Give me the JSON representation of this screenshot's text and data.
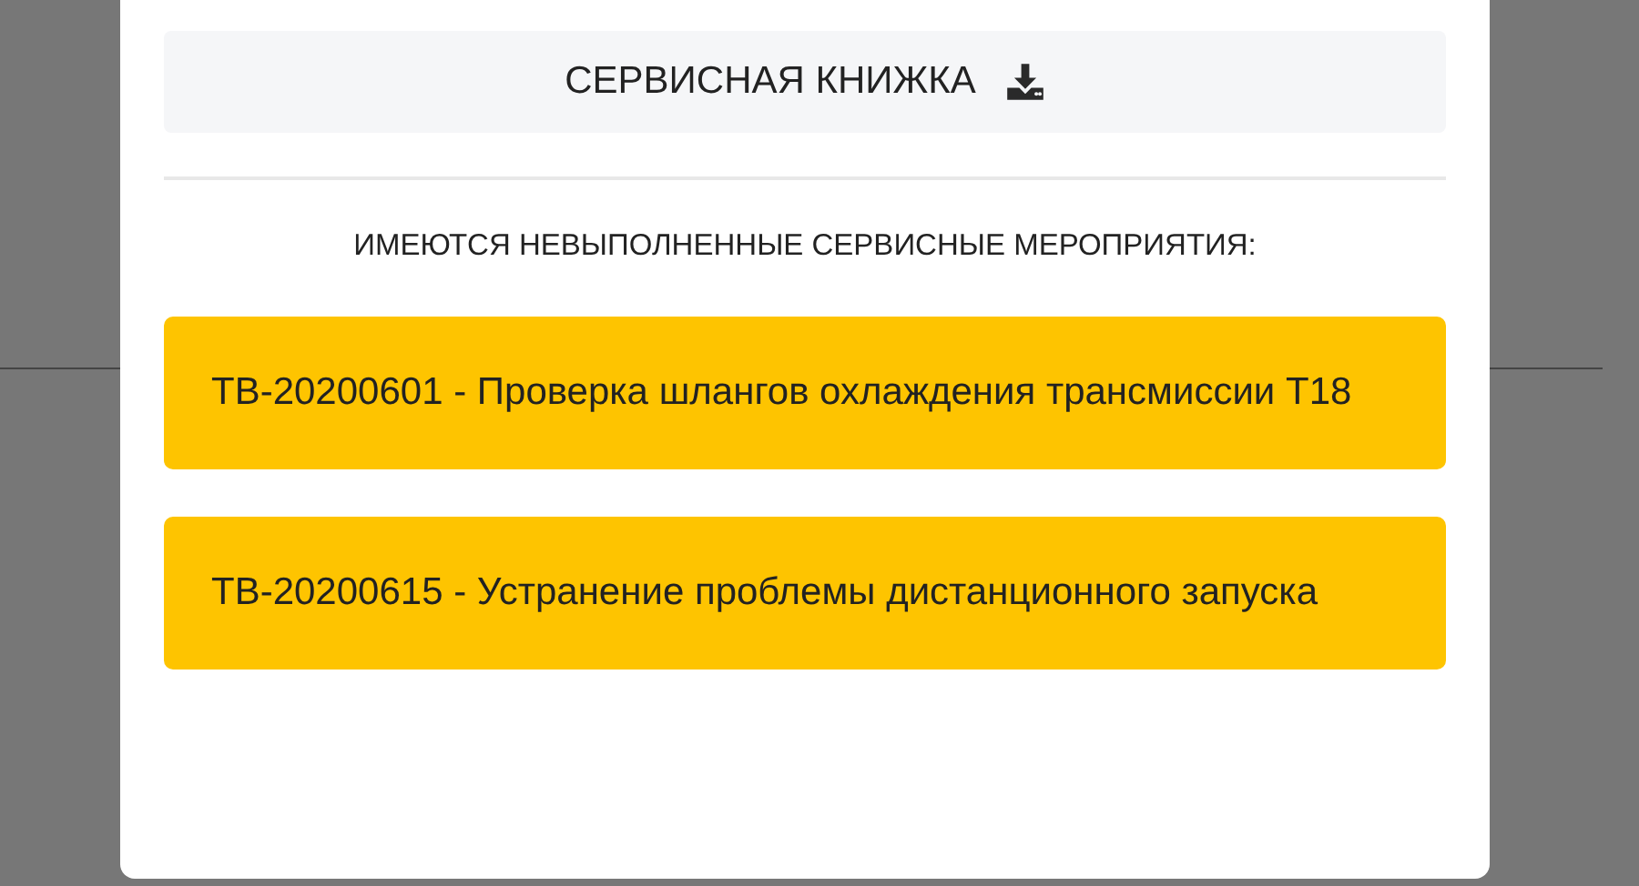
{
  "modal": {
    "button": {
      "label": "СЕРВИСНАЯ КНИЖКА"
    },
    "heading": "ИМЕЮТСЯ НЕВЫПОЛНЕННЫЕ СЕРВИСНЫЕ МЕРОПРИЯТИЯ:",
    "alerts": [
      {
        "text": "ТВ-20200601 - Проверка шлангов охлаждения трансмиссии Т18",
        "color": "#fec400"
      },
      {
        "text": "ТВ-20200615 - Устранение проблемы дистанционного запуска",
        "color": "#fec400"
      }
    ]
  }
}
